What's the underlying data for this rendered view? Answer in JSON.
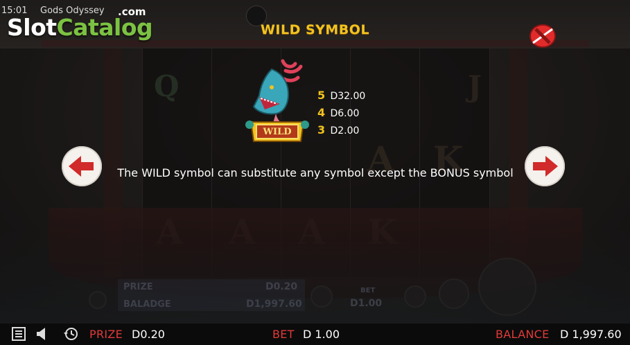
{
  "status_bar": {
    "time": "15:01",
    "game_name": "Gods Odyssey"
  },
  "watermark": {
    "brand_slot": "Slot",
    "brand_catalog": "Catalog",
    "brand_com": ".com"
  },
  "paytable": {
    "title": "WILD SYMBOL",
    "symbol_badge": "WILD",
    "payouts": [
      {
        "count": "5",
        "amount": "D32.00"
      },
      {
        "count": "4",
        "amount": "D6.00"
      },
      {
        "count": "3",
        "amount": "D2.00"
      }
    ],
    "description": "The WILD symbol can substitute any symbol except the BONUS symbol"
  },
  "background_panel": {
    "prize_label": "PRIZE",
    "prize_value": "D0.20",
    "balance_label": "BALADGE",
    "balance_value": "D1,997.60",
    "bet_label": "BET",
    "bet_value": "D1.00"
  },
  "bottom_bar": {
    "prize_label": "PRIZE",
    "prize_value": "D0.20",
    "bet_label": "BET",
    "bet_value": "D 1.00",
    "balance_label": "BALANCE",
    "balance_value": "D 1,997.60"
  },
  "icons": [
    "menu-icon",
    "sound-icon",
    "history-icon",
    "close-icon",
    "arrow-left-icon",
    "arrow-right-icon"
  ],
  "colors": {
    "accent_gold": "#f2c31f",
    "label_red": "#e23a3a",
    "logo_green": "#7cc242"
  }
}
